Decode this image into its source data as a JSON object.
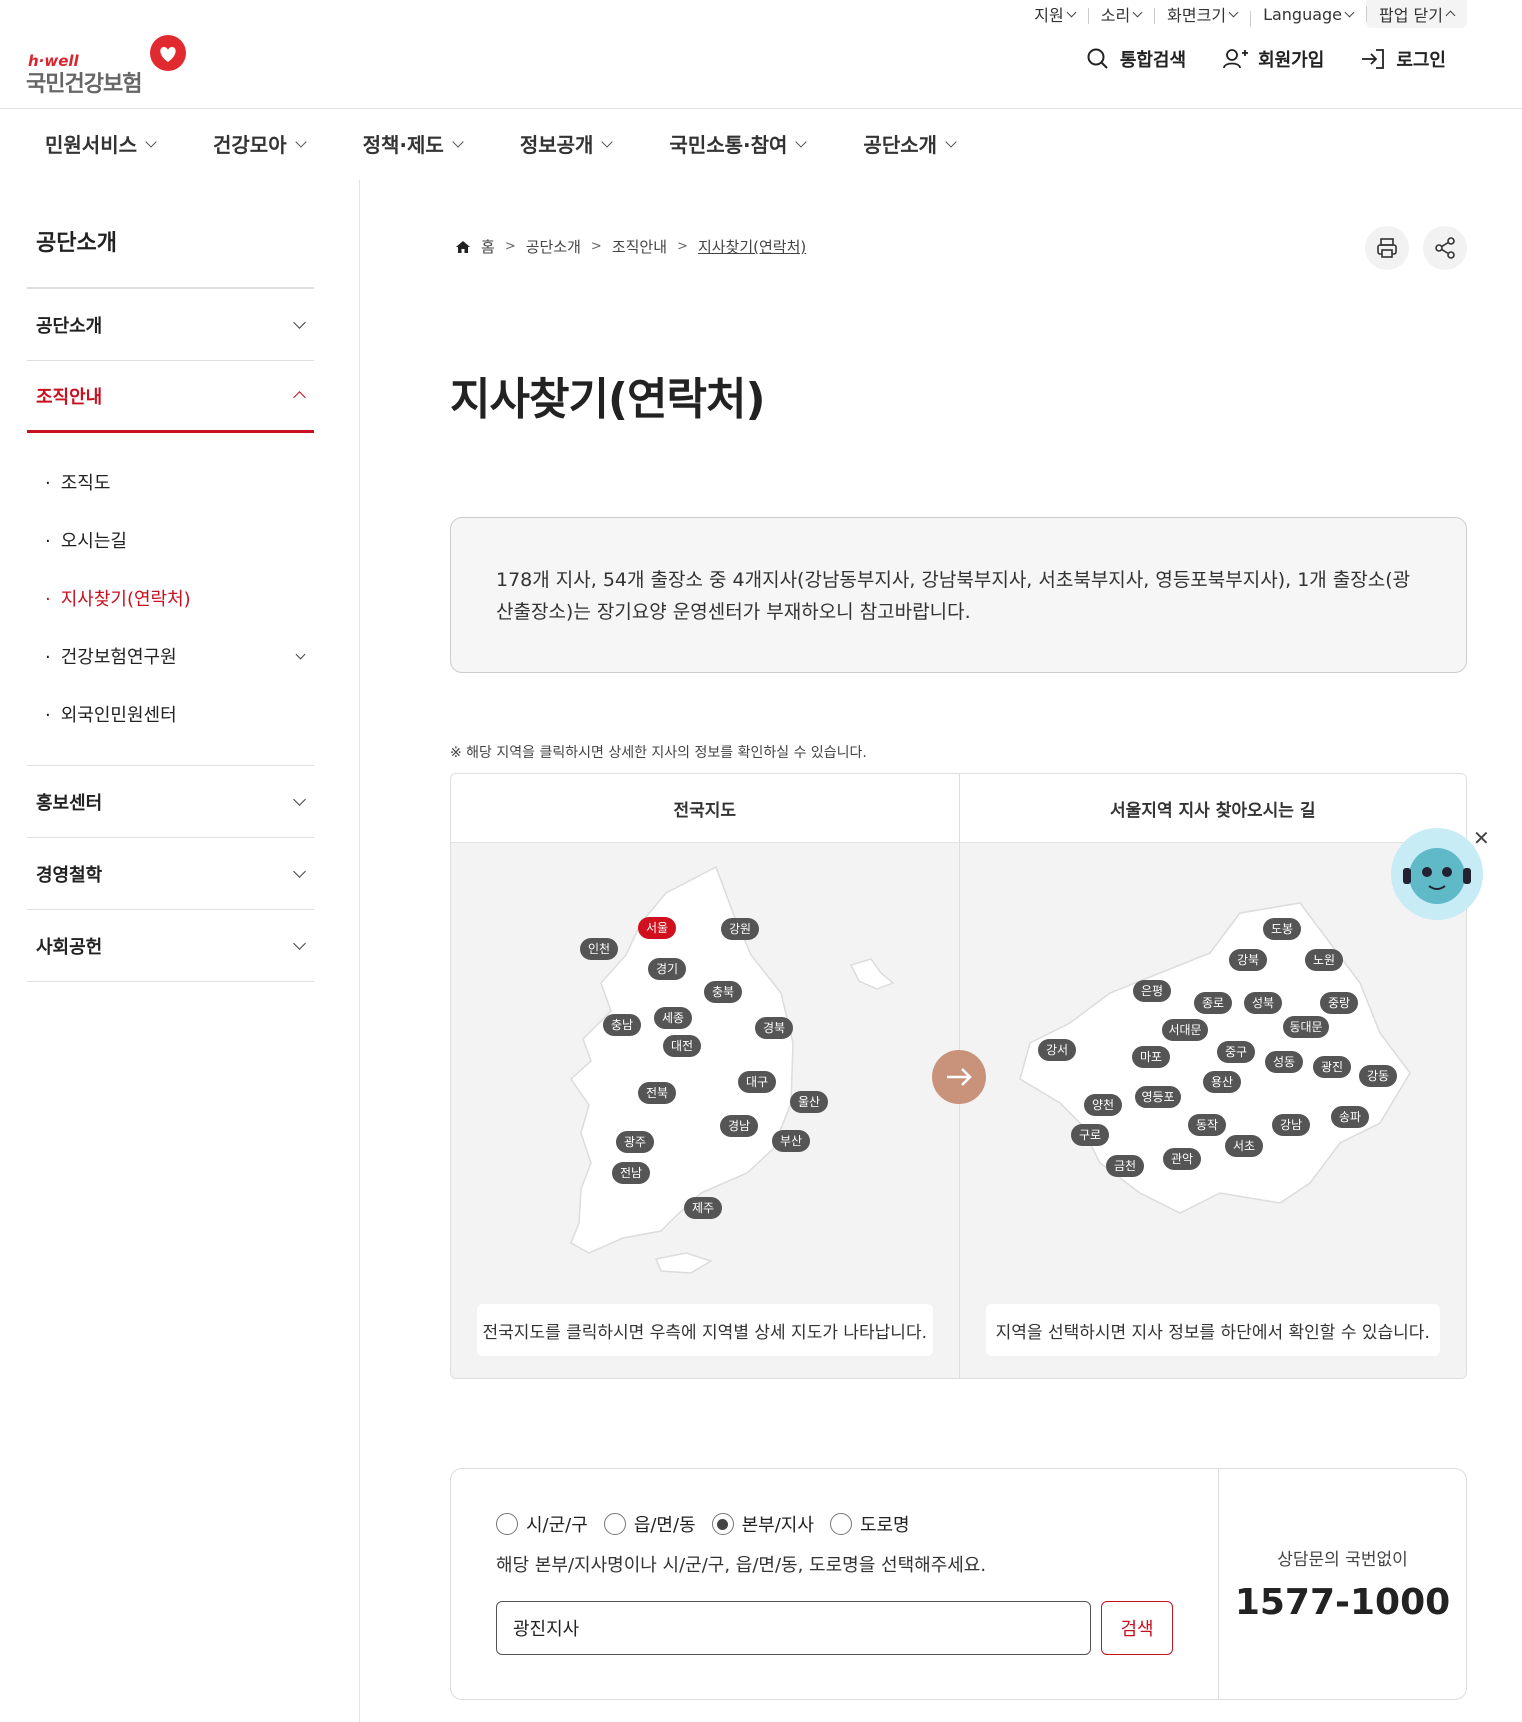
{
  "util": [
    "지원",
    "소리",
    "화면크기",
    "Language",
    "팝업 닫기"
  ],
  "logo": {
    "hwell": "h·well",
    "name": "국민건강보험"
  },
  "actions": {
    "search": "통합검색",
    "join": "회원가입",
    "login": "로그인"
  },
  "gnb": [
    "민원서비스",
    "건강모아",
    "정책·제도",
    "정보공개",
    "국민소통·참여",
    "공단소개"
  ],
  "lnb": {
    "title": "공단소개",
    "items": [
      "공단소개",
      "조직안내",
      "홍보센터",
      "경영철학",
      "사회공헌"
    ],
    "sub": [
      "조직도",
      "오시는길",
      "지사찾기(연락처)",
      "건강보험연구원",
      "외국인민원센터"
    ]
  },
  "breadcrumb": [
    "홈",
    "공단소개",
    "조직안내",
    "지사찾기(연락처)"
  ],
  "page_title": "지사찾기(연락처)",
  "notice": "178개 지사, 54개 출장소 중 4개지사(강남동부지사, 강남북부지사, 서초북부지사, 영등포북부지사), 1개 출장소(광산출장소)는 장기요양 운영센터가 부재하오니 참고바랍니다.",
  "hint": "※ 해당 지역을 클릭하시면 상세한 지사의 정보를 확인하실 수 있습니다.",
  "maps": {
    "national": {
      "head": "전국지도",
      "caption": "전국지도를 클릭하시면 우측에 지역별 상세 지도가 나타납니다.",
      "regions": [
        "서울",
        "강원",
        "인천",
        "경기",
        "충북",
        "세종",
        "충남",
        "대전",
        "경북",
        "대구",
        "전북",
        "울산",
        "경남",
        "부산",
        "광주",
        "전남",
        "제주"
      ]
    },
    "seoul": {
      "head": "서울지역 지사 찾아오시는 길",
      "caption": "지역을 선택하시면 지사 정보를 하단에서 확인할 수 있습니다.",
      "regions": [
        "도봉",
        "강북",
        "노원",
        "은평",
        "종로",
        "성북",
        "중랑",
        "서대문",
        "동대문",
        "강서",
        "마포",
        "중구",
        "성동",
        "광진",
        "강동",
        "용산",
        "양천",
        "영등포",
        "동작",
        "강남",
        "송파",
        "구로",
        "서초",
        "금천",
        "관악"
      ]
    }
  },
  "search": {
    "radios": [
      "시/군/구",
      "읍/면/동",
      "본부/지사",
      "도로명"
    ],
    "guide": "해당 본부/지사명이나 시/군/구, 읍/면/동, 도로명을 선택해주세요.",
    "value": "광진지사",
    "button": "검색",
    "contact_label": "상담문의 국번없이",
    "contact_number": "1577-1000"
  },
  "colors": {
    "accent": "#c8101f",
    "pill": "#555555",
    "map_bg": "#f3f3f3"
  }
}
